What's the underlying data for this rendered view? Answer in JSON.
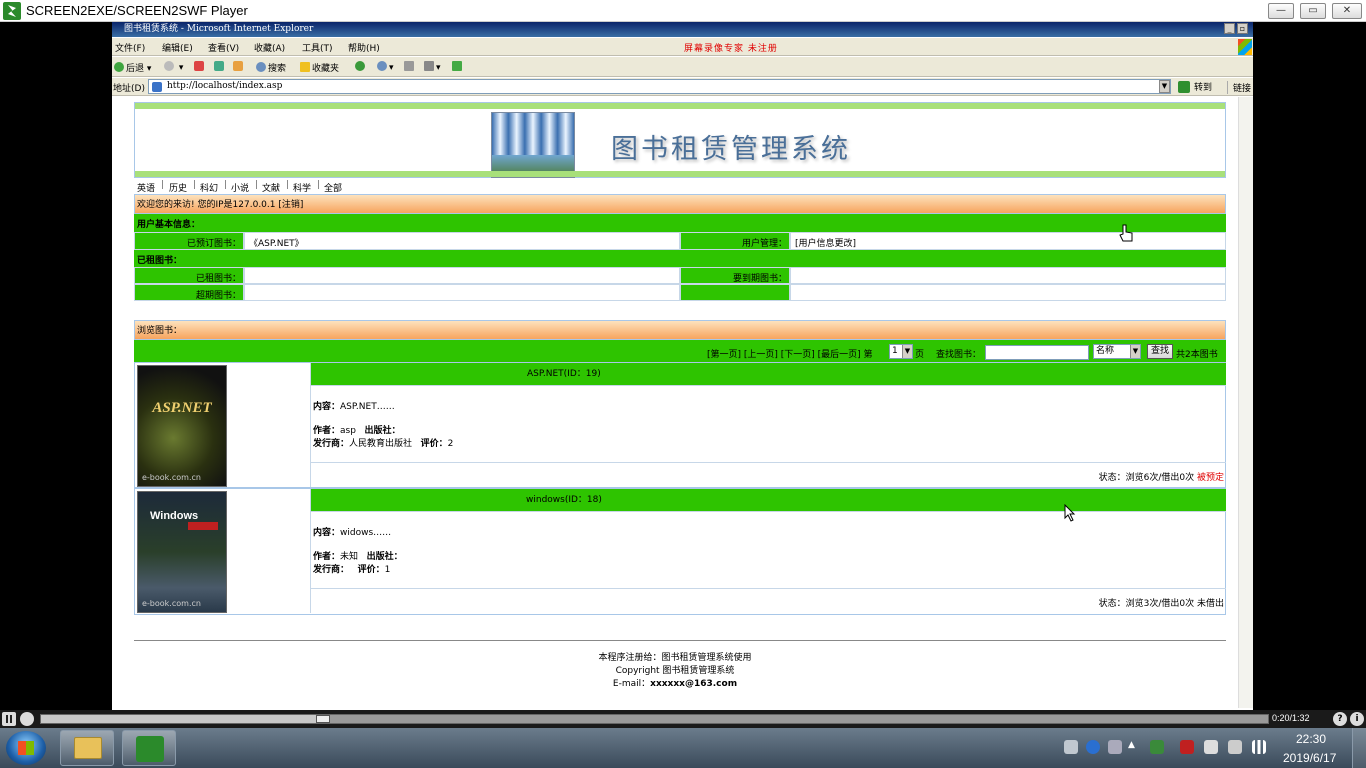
{
  "player": {
    "title": "SCREEN2EXE/SCREEN2SWF Player",
    "time": "0:20/1:32",
    "progress": 0.23,
    "help_label": "?",
    "info_label": "i"
  },
  "ie": {
    "title": "图书租赁系统 - Microsoft Internet Explorer",
    "menu": [
      "文件(F)",
      "编辑(E)",
      "查看(V)",
      "收藏(A)",
      "工具(T)",
      "帮助(H)"
    ],
    "watermark": "屏幕录像专家  未注册",
    "toolbar": {
      "back": "后退",
      "search": "搜索",
      "favorites": "收藏夹"
    },
    "address_label": "地址(D)",
    "address": "http://localhost/index.asp",
    "go": "转到",
    "links": "链接"
  },
  "page": {
    "banner_title": "图书租赁管理系统",
    "categories": [
      "英语",
      "历史",
      "科幻",
      "小说",
      "文献",
      "科学",
      "全部"
    ],
    "welcome": "欢迎您的来访! 您的IP是127.0.0.1 [注销]",
    "user_info": {
      "section_title": "用户基本信息：",
      "reserved_label": "已预订图书：",
      "reserved_value": "《ASP.NET》",
      "user_mgmt_label": "用户管理：",
      "user_mgmt_value": "[用户信息更改]",
      "rented_section": "已租图书：",
      "rented_label": "已租图书：",
      "due_label": "要到期图书：",
      "overdue_label": "超期图书："
    },
    "browse": {
      "title": "浏览图书：",
      "pager": "[第一页] [上一页] [下一页] [最后一页] 第",
      "page_num": "1",
      "page_suffix": "页",
      "search_label": "查找图书：",
      "search_field": "名称",
      "search_button": "查找",
      "total": "共2本图书"
    },
    "books": [
      {
        "title": "ASP.NET(ID：19)",
        "content_label": "内容：",
        "content": "ASP.NET……",
        "author_label": "作者：",
        "author": "asp",
        "publisher_label": "出版社：",
        "publisher": "",
        "distributor_label": "发行商：",
        "distributor": "人民教育出版社",
        "rating_label": "评价：",
        "rating": "2",
        "status": "状态：浏览6次/借出0次",
        "status_flag": "被预定",
        "cover_text": "ASP.NET",
        "cover_bottom": "e-book.com.cn"
      },
      {
        "title": "windows(ID：18)",
        "content_label": "内容：",
        "content": "widows……",
        "author_label": "作者：",
        "author": "未知",
        "publisher_label": "出版社：",
        "publisher": "",
        "distributor_label": "发行商：",
        "distributor": "",
        "rating_label": "评价：",
        "rating": "1",
        "status": "状态：浏览3次/借出0次",
        "status_flag": "未借出",
        "cover_text": "Windows",
        "cover_bottom": "e-book.com.cn"
      }
    ],
    "footer": {
      "line1": "本程序注册给：图书租赁管理系统使用",
      "line2": "Copyright 图书租赁管理系统",
      "line3_label": "E-mail：",
      "line3_value": "xxxxxx@163.com"
    }
  },
  "taskbar": {
    "clock_time": "22:30",
    "clock_date": "2019/6/17"
  },
  "colors": {
    "page_green": "#2ec400",
    "watermark_red": "#e00000",
    "reserved_red": "#e00000"
  }
}
